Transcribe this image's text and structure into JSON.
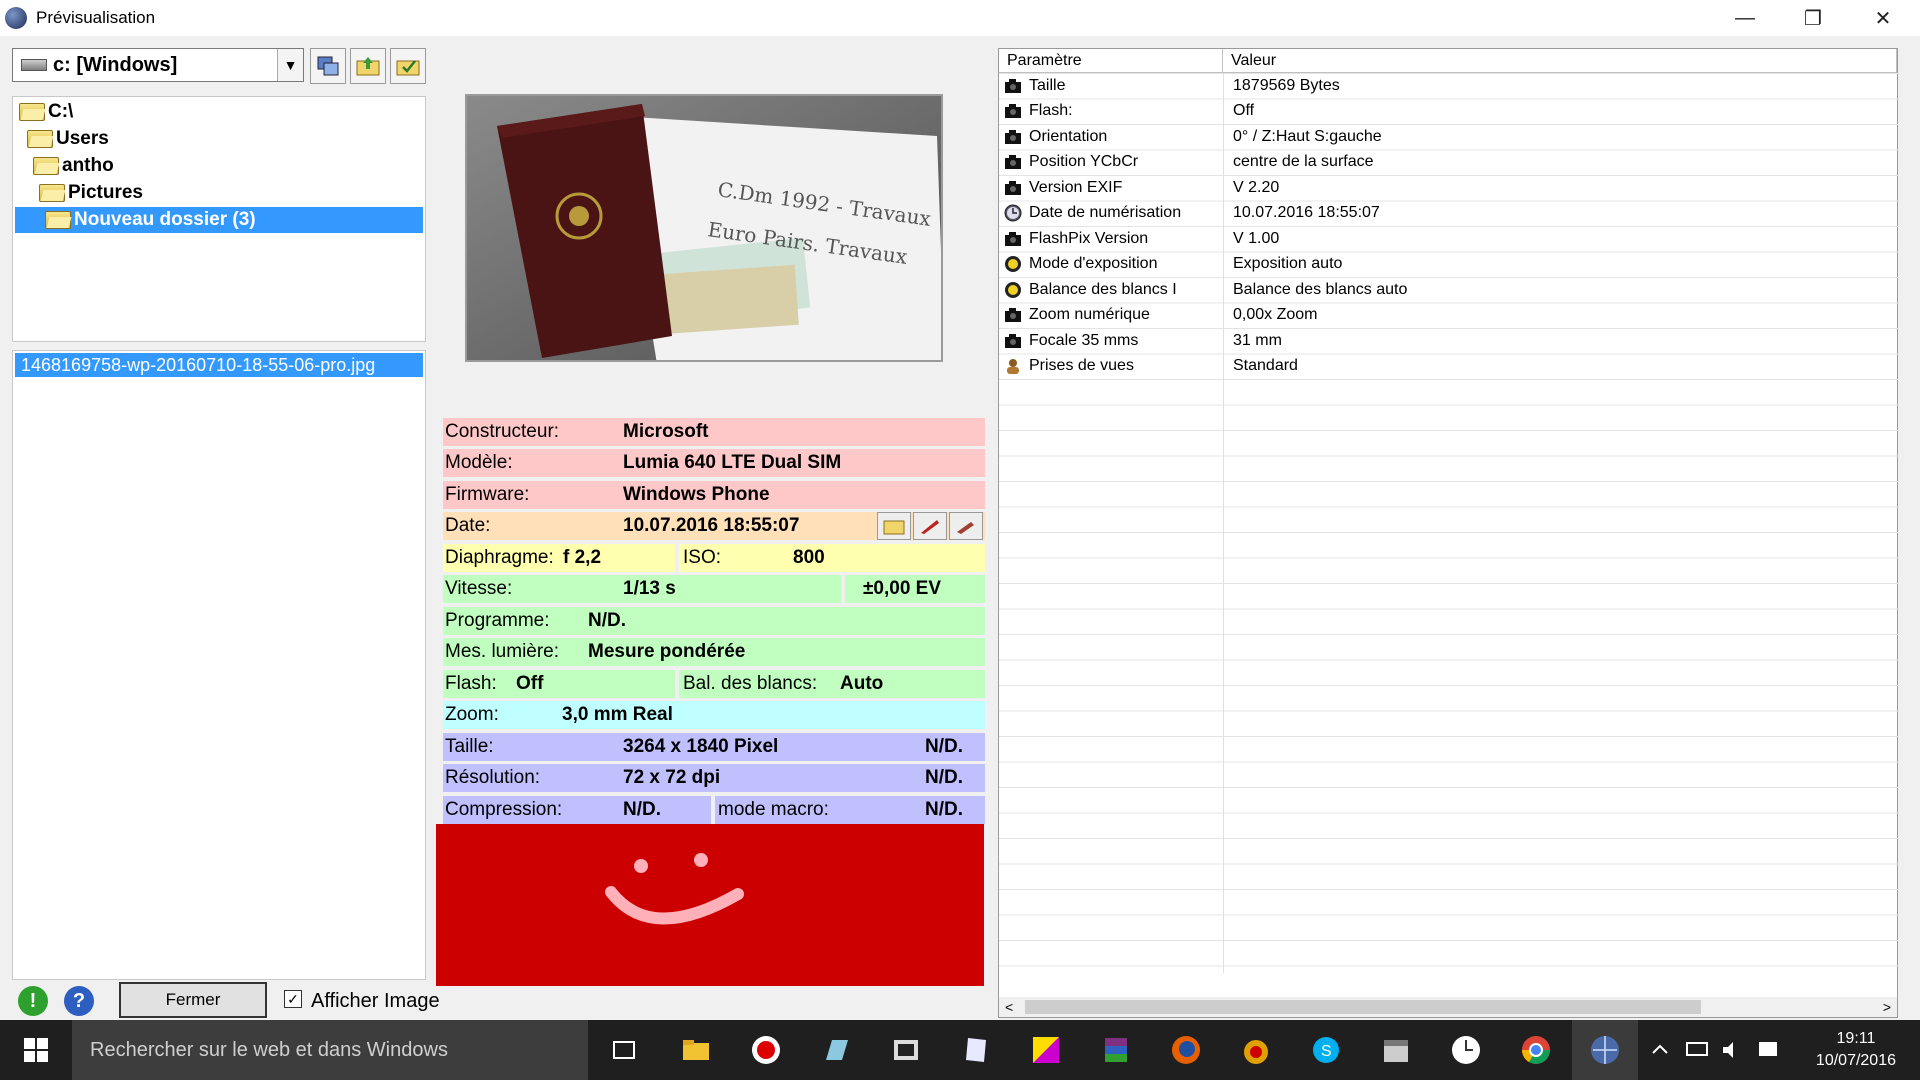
{
  "window": {
    "title": "Prévisualisation",
    "minimize": "—",
    "maximize": "❐",
    "close": "✕"
  },
  "drive": {
    "label": "c: [Windows]"
  },
  "tree": [
    {
      "label": "C:\\",
      "indent": 0
    },
    {
      "label": "Users",
      "indent": 1
    },
    {
      "label": "antho",
      "indent": 2
    },
    {
      "label": "Pictures",
      "indent": 3
    },
    {
      "label": "Nouveau dossier (3)",
      "indent": 4
    }
  ],
  "files": {
    "selected": "1468169758-wp-20160710-18-55-06-pro.jpg"
  },
  "bottom": {
    "close_label": "Fermer",
    "show_image_label": "Afficher Image",
    "show_image_checked": "✓"
  },
  "photo_handwriting": "C.Dm 1992 - Travaux\nEuro Pairs. Travaux",
  "exif": {
    "constructeur": {
      "label": "Constructeur:",
      "value": "Microsoft"
    },
    "modele": {
      "label": "Modèle:",
      "value": "Lumia 640 LTE Dual SIM"
    },
    "firmware": {
      "label": "Firmware:",
      "value": "Windows Phone"
    },
    "date": {
      "label": "Date:",
      "value": "10.07.2016 18:55:07"
    },
    "diaphragme": {
      "label": "Diaphragme:",
      "value": "f 2,2"
    },
    "iso": {
      "label": "ISO:",
      "value": "800"
    },
    "vitesse": {
      "label": "Vitesse:",
      "value": "1/13 s"
    },
    "ev": {
      "value": "±0,00 EV"
    },
    "programme": {
      "label": "Programme:",
      "value": "N/D."
    },
    "mesure": {
      "label": "Mes. lumière:",
      "value": "Mesure pondérée"
    },
    "flash": {
      "label": "Flash:",
      "value": "Off"
    },
    "balance": {
      "label": "Bal. des blancs:",
      "value": "Auto"
    },
    "zoom": {
      "label": "Zoom:",
      "value": "3,0 mm Real"
    },
    "taille": {
      "label": "Taille:",
      "value": "3264 x 1840 Pixel",
      "extra": "N/D."
    },
    "resolution": {
      "label": "Résolution:",
      "value": "72 x 72 dpi",
      "extra": "N/D."
    },
    "compression": {
      "label": "Compression:",
      "value": "N/D."
    },
    "macro": {
      "label": "mode macro:",
      "value": "N/D."
    }
  },
  "params": {
    "headers": {
      "name": "Paramètre",
      "value": "Valeur"
    },
    "rows": [
      {
        "name": "Taille",
        "value": "1879569 Bytes",
        "icon": "camera-icon"
      },
      {
        "name": "Flash:",
        "value": "Off",
        "icon": "camera-icon"
      },
      {
        "name": "Orientation",
        "value": "0° / Z:Haut S:gauche",
        "icon": "camera-icon"
      },
      {
        "name": "Position YCbCr",
        "value": "centre de la surface",
        "icon": "camera-icon"
      },
      {
        "name": "Version EXIF",
        "value": "V 2.20",
        "icon": "camera-icon"
      },
      {
        "name": "Date de numérisation",
        "value": "10.07.2016 18:55:07",
        "icon": "clock-icon"
      },
      {
        "name": "FlashPix Version",
        "value": "V 1.00",
        "icon": "camera-icon"
      },
      {
        "name": "Mode d'exposition",
        "value": "Exposition auto",
        "icon": "sun-icon"
      },
      {
        "name": "Balance des blancs I",
        "value": "Balance des blancs auto",
        "icon": "sun-icon"
      },
      {
        "name": "Zoom numérique",
        "value": "0,00x Zoom",
        "icon": "camera-icon"
      },
      {
        "name": "Focale 35 mms",
        "value": "31 mm",
        "icon": "camera-icon"
      },
      {
        "name": "Prises de vues",
        "value": "Standard",
        "icon": "person-icon"
      }
    ]
  },
  "taskbar": {
    "search_placeholder": "Rechercher sur le web et dans Windows",
    "time": "19:11",
    "date": "10/07/2016"
  }
}
